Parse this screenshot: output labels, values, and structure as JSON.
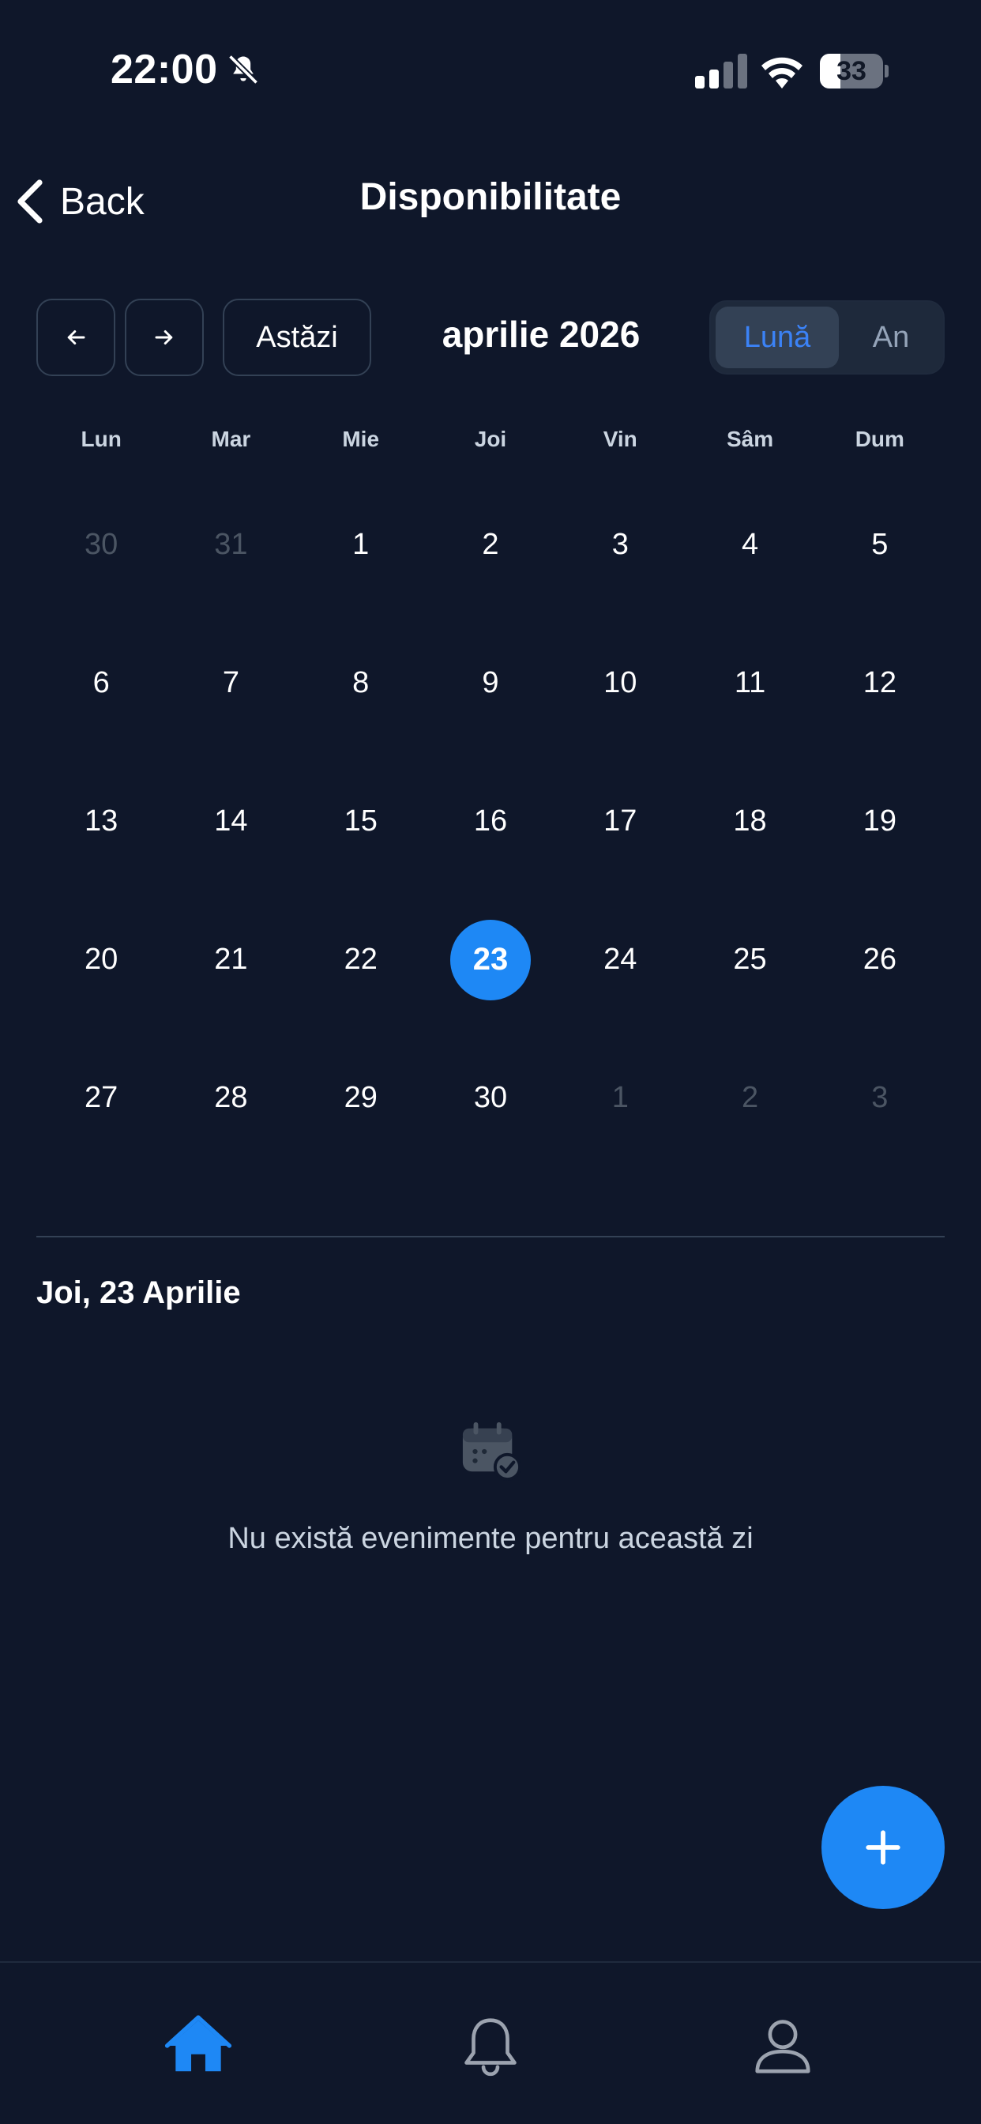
{
  "status_bar": {
    "time": "22:00",
    "battery_level": "33",
    "battery_percent": 33
  },
  "header": {
    "back_label": "Back",
    "title": "Disponibilitate"
  },
  "toolbar": {
    "today_label": "Astăzi",
    "month_title": "aprilie 2026",
    "view_month_label": "Lună",
    "view_year_label": "An",
    "active_view": "month"
  },
  "calendar": {
    "weekdays": [
      "Lun",
      "Mar",
      "Mie",
      "Joi",
      "Vin",
      "Sâm",
      "Dum"
    ],
    "weeks": [
      [
        "30",
        "31",
        "1",
        "2",
        "3",
        "4",
        "5"
      ],
      [
        "6",
        "7",
        "8",
        "9",
        "10",
        "11",
        "12"
      ],
      [
        "13",
        "14",
        "15",
        "16",
        "17",
        "18",
        "19"
      ],
      [
        "20",
        "21",
        "22",
        "23",
        "24",
        "25",
        "26"
      ],
      [
        "27",
        "28",
        "29",
        "30",
        "1",
        "2",
        "3"
      ]
    ],
    "outside_month": [
      [
        0,
        0
      ],
      [
        0,
        1
      ],
      [
        4,
        4
      ],
      [
        4,
        5
      ],
      [
        4,
        6
      ]
    ],
    "selected": [
      3,
      3
    ]
  },
  "day_panel": {
    "selected_date": "Joi, 23 Aprilie",
    "empty_message": "Nu există evenimente pentru această zi",
    "empty_icon": "calendar-check-icon"
  },
  "colors": {
    "background": "#0f172a",
    "accent": "#1e88f5",
    "muted_text": "#4b5563"
  },
  "tab_bar": {
    "items": [
      {
        "icon": "home-icon",
        "active": true
      },
      {
        "icon": "bell-icon",
        "active": false
      },
      {
        "icon": "user-icon",
        "active": false
      }
    ]
  }
}
